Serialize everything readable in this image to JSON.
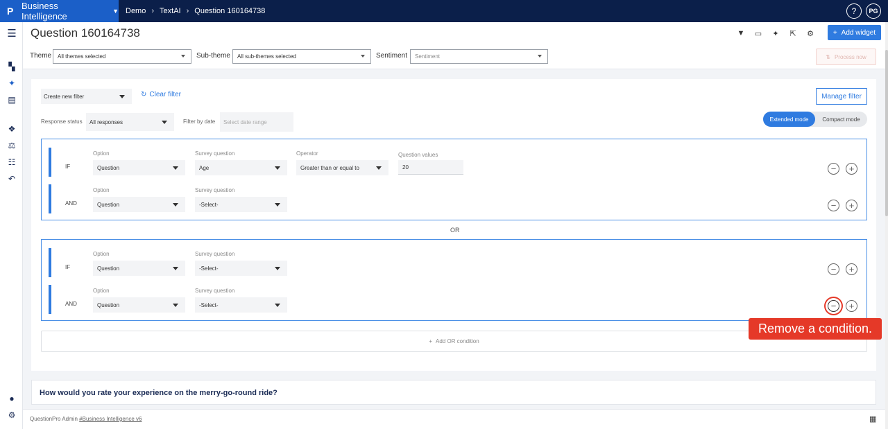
{
  "topbar": {
    "logo": "P",
    "app_name": "Business Intelligence",
    "breadcrumbs": [
      "Demo",
      "TextAI",
      "Question 160164738"
    ],
    "help_label": "?",
    "user_initials": "PG"
  },
  "header": {
    "title": "Question 160164738",
    "add_widget_label": "Add widget",
    "process_now_label": "Process now",
    "filters": {
      "theme_label": "Theme",
      "theme_value": "All themes selected",
      "subtheme_label": "Sub-theme",
      "subtheme_value": "All sub-themes selected",
      "sentiment_label": "Sentiment",
      "sentiment_placeholder": "Sentiment"
    }
  },
  "panel": {
    "create_filter": "Create new filter",
    "clear_filter": "Clear filter",
    "manage_filter": "Manage filter",
    "response_status_label": "Response status",
    "response_status_value": "All responses",
    "filter_by_date_label": "Filter by date",
    "date_placeholder": "Select date range",
    "mode_extended": "Extended mode",
    "mode_compact": "Compact mode",
    "or_label": "OR",
    "add_or_condition": "Add OR condition",
    "groups": [
      {
        "conditions": [
          {
            "keyword": "IF",
            "option_label": "Option",
            "option_value": "Question",
            "survey_label": "Survey question",
            "survey_value": "Age",
            "operator_label": "Operator",
            "operator_value": "Greater than or equal to",
            "values_label": "Question values",
            "values_value": "20"
          },
          {
            "keyword": "AND",
            "option_label": "Option",
            "option_value": "Question",
            "survey_label": "Survey question",
            "survey_value": "-Select-"
          }
        ]
      },
      {
        "conditions": [
          {
            "keyword": "IF",
            "option_label": "Option",
            "option_value": "Question",
            "survey_label": "Survey question",
            "survey_value": "-Select-"
          },
          {
            "keyword": "AND",
            "option_label": "Option",
            "option_value": "Question",
            "survey_label": "Survey question",
            "survey_value": "-Select-"
          }
        ]
      }
    ]
  },
  "tooltip": "Remove a condition.",
  "question_card": {
    "title": "How would you rate your experience on the merry-go-round ride?"
  },
  "footer": {
    "text": "QuestionPro Admin",
    "link": "#Business Intelligence v6"
  },
  "colors": {
    "topbar": "#0b1f4a",
    "brand": "#1b5fc8",
    "accent": "#2f7be0",
    "highlight": "#e53928"
  },
  "icons": [
    "menu-icon",
    "dashboard-icon",
    "sparkle-icon",
    "report-icon",
    "widgets-icon",
    "balance-icon",
    "list-icon",
    "back-icon",
    "user-shield-icon",
    "gear-icon",
    "filter-icon",
    "csv-icon",
    "share-icon",
    "plus-icon",
    "refresh-icon",
    "minus-circle-icon",
    "plus-circle-icon",
    "grid-icon"
  ]
}
